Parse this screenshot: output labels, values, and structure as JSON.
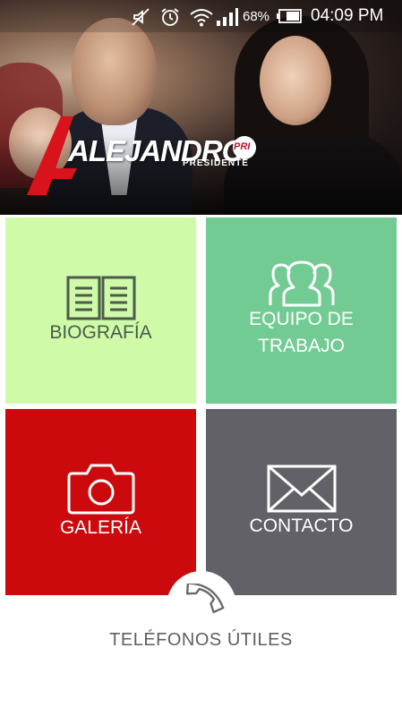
{
  "status_bar": {
    "battery_percent": "68%",
    "time": "04:09 PM",
    "icons": [
      "mute-icon",
      "alarm-icon",
      "wifi-icon",
      "signal-icon",
      "battery-icon"
    ]
  },
  "hero": {
    "logo_name": "ALEJANDRO",
    "logo_tagline": "PRESIDENTE",
    "party_badge": "PRI"
  },
  "tiles": [
    {
      "id": "biografia",
      "label": "BIOGRAFÍA",
      "icon": "book-icon",
      "bg": "#cffba9",
      "fg": "#4b5a4b"
    },
    {
      "id": "equipo",
      "label_line1": "EQUIPO DE",
      "label_line2": "TRABAJO",
      "icon": "team-icon",
      "bg": "#72cb93",
      "fg": "#ffffff"
    },
    {
      "id": "galeria",
      "label": "GALERÍA",
      "icon": "camera-icon",
      "bg": "#cc090d",
      "fg": "#ffffff"
    },
    {
      "id": "contacto",
      "label": "CONTACTO",
      "icon": "envelope-icon",
      "bg": "#636168",
      "fg": "#ffffff"
    }
  ],
  "bottom": {
    "label": "TELÉFONOS ÚTILES",
    "icon": "phone-icon"
  }
}
